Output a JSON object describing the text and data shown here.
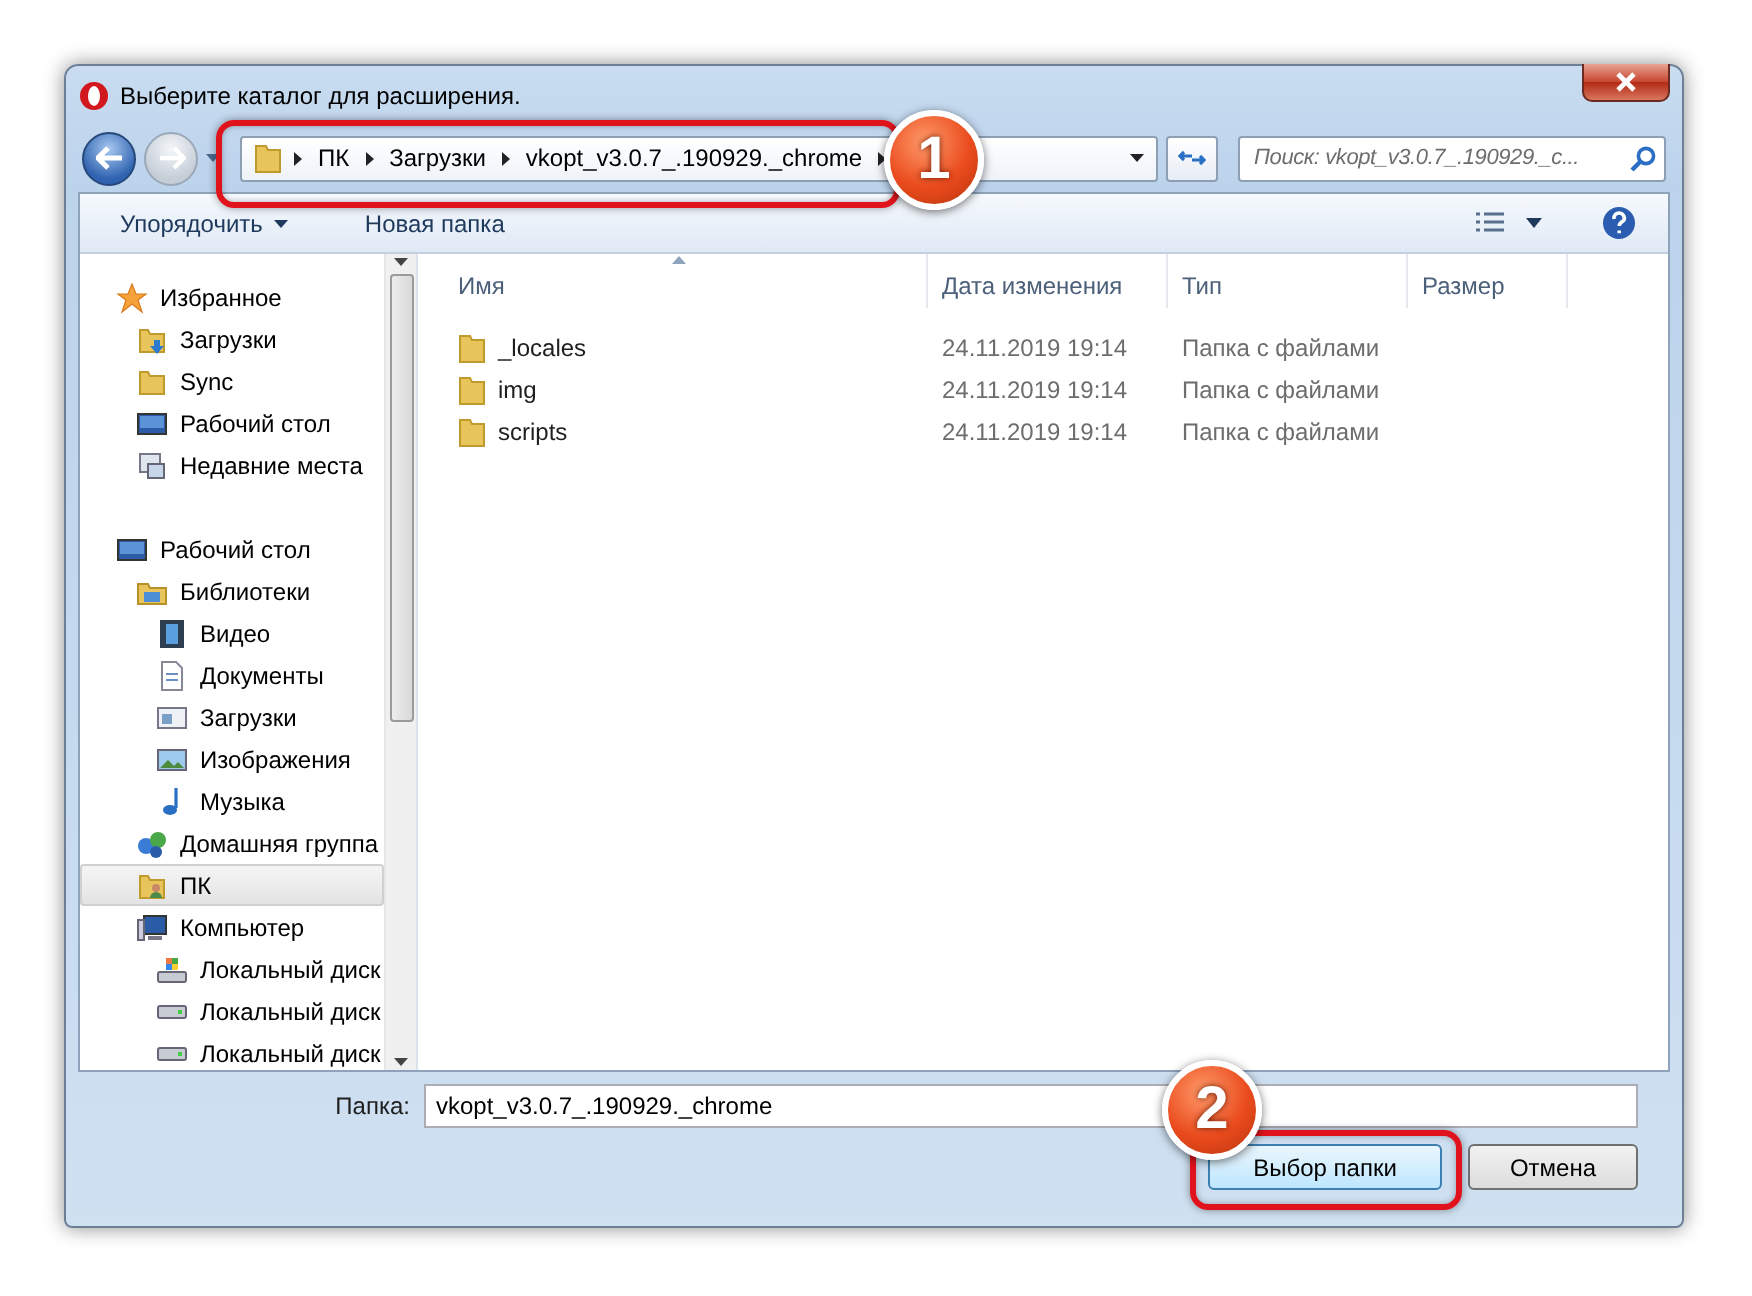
{
  "window": {
    "title": "Выберите каталог для расширения."
  },
  "address_bar": {
    "crumbs": [
      "ПК",
      "Загрузки",
      "vkopt_v3.0.7_.190929._chrome"
    ]
  },
  "search": {
    "placeholder": "Поиск: vkopt_v3.0.7_.190929._c..."
  },
  "toolbar": {
    "organize": "Упорядочить",
    "new_folder": "Новая папка"
  },
  "sidebar": {
    "items": [
      {
        "label": "Избранное",
        "kind": "favorites",
        "selected": false,
        "children": [
          {
            "label": "Загрузки",
            "kind": "downloads",
            "selected": false
          },
          {
            "label": "Sync",
            "kind": "folder",
            "selected": false
          },
          {
            "label": "Рабочий стол",
            "kind": "desktop",
            "selected": false
          },
          {
            "label": "Недавние места",
            "kind": "recent",
            "selected": false
          }
        ]
      },
      {
        "label": "Рабочий стол",
        "kind": "desktop",
        "selected": false,
        "children": [
          {
            "label": "Библиотеки",
            "kind": "library",
            "selected": false,
            "children": [
              {
                "label": "Видео",
                "kind": "video",
                "selected": false
              },
              {
                "label": "Документы",
                "kind": "document",
                "selected": false
              },
              {
                "label": "Загрузки",
                "kind": "window",
                "selected": false
              },
              {
                "label": "Изображения",
                "kind": "image",
                "selected": false
              },
              {
                "label": "Музыка",
                "kind": "music",
                "selected": false
              }
            ]
          },
          {
            "label": "Домашняя группа",
            "kind": "homegroup",
            "selected": false
          },
          {
            "label": "ПК",
            "kind": "user",
            "selected": true
          },
          {
            "label": "Компьютер",
            "kind": "computer",
            "selected": false,
            "children": [
              {
                "label": "Локальный диск",
                "kind": "system_disk",
                "selected": false
              },
              {
                "label": "Локальный диск",
                "kind": "disk",
                "selected": false
              },
              {
                "label": "Локальный диск",
                "kind": "disk",
                "selected": false
              }
            ]
          }
        ]
      }
    ]
  },
  "file_list": {
    "columns": [
      {
        "label": "Имя",
        "sorted": true
      },
      {
        "label": "Дата изменения",
        "sorted": false
      },
      {
        "label": "Тип",
        "sorted": false
      },
      {
        "label": "Размер",
        "sorted": false
      }
    ],
    "rows": [
      {
        "name": "_locales",
        "date": "24.11.2019 19:14",
        "type": "Папка с файлами"
      },
      {
        "name": "img",
        "date": "24.11.2019 19:14",
        "type": "Папка с файлами"
      },
      {
        "name": "scripts",
        "date": "24.11.2019 19:14",
        "type": "Папка с файлами"
      }
    ]
  },
  "folder_field": {
    "label": "Папка:",
    "value": "vkopt_v3.0.7_.190929._chrome"
  },
  "buttons": [
    {
      "label": "Выбор папки",
      "kind": "primary"
    },
    {
      "label": "Отмена",
      "kind": "cancel"
    }
  ],
  "callouts": [
    {
      "number": "1"
    },
    {
      "number": "2"
    }
  ]
}
